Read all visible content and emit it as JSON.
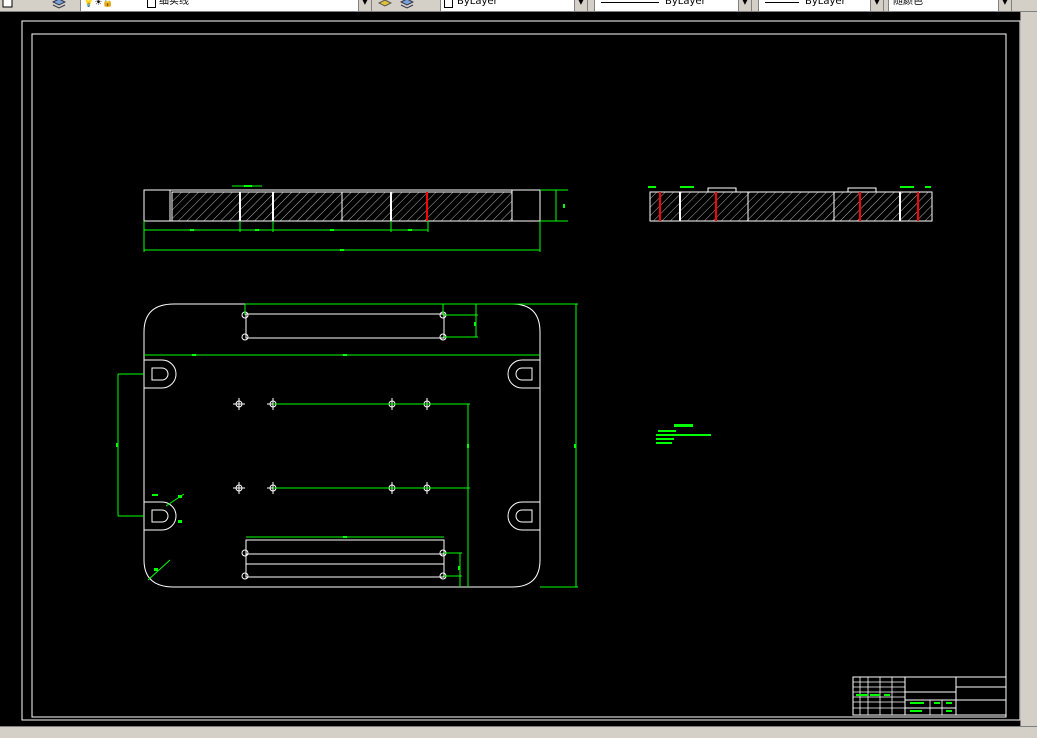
{
  "toolbar": {
    "layer_name": "细实线",
    "color_value": "ByLayer",
    "linetype_value": "ByLayer",
    "lineweight_value": "ByLayer",
    "plotstyle_value": "随颜色"
  },
  "colors": {
    "background": "#000000",
    "frame": "#ffffff",
    "dimension": "#00ff00",
    "section_line": "#ff0000",
    "toolbar": "#d4d0c8"
  },
  "icons": [
    "layers-icon",
    "layer-state-icons",
    "layer-previous-icon",
    "match-properties-icon"
  ]
}
